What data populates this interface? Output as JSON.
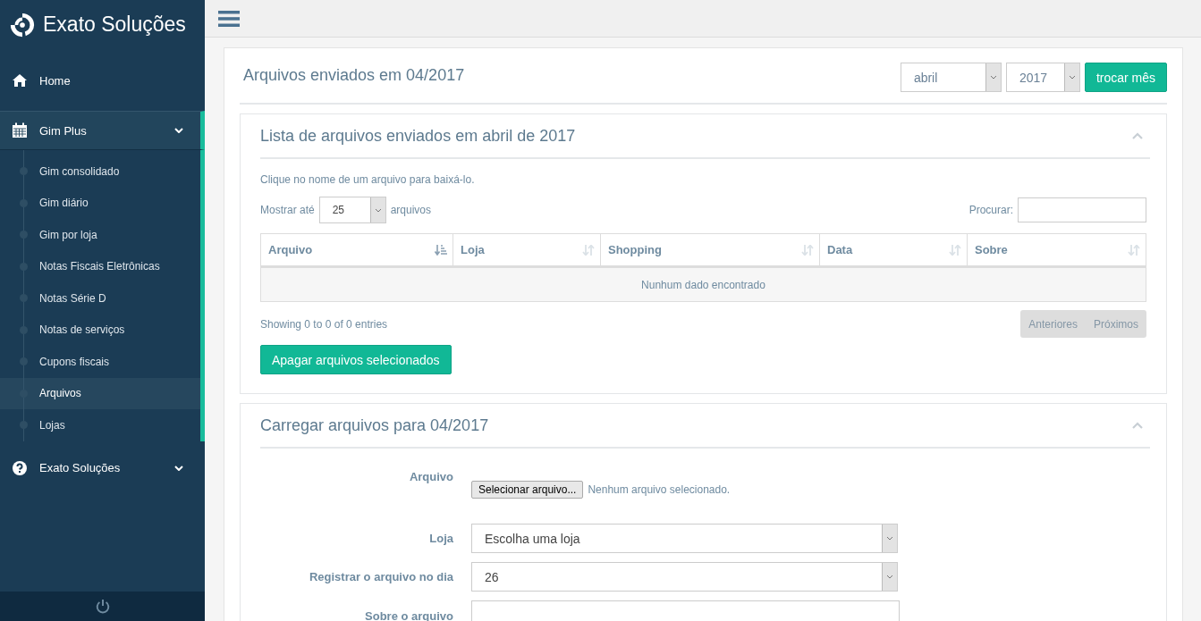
{
  "sidebar": {
    "brand": "Exato Soluções",
    "items": [
      {
        "label": "Home",
        "kind": "link"
      },
      {
        "label": "Gim Plus",
        "kind": "group",
        "expanded": true,
        "children": [
          {
            "label": "Gim consolidado",
            "selected": false
          },
          {
            "label": "Gim diário",
            "selected": false
          },
          {
            "label": "Gim por loja",
            "selected": false
          },
          {
            "label": "Notas Fiscais Eletrônicas",
            "selected": false
          },
          {
            "label": "Notas Série D",
            "selected": false
          },
          {
            "label": "Notas de serviços",
            "selected": false
          },
          {
            "label": "Cupons fiscais",
            "selected": false
          },
          {
            "label": "Arquivos",
            "selected": true
          },
          {
            "label": "Lojas",
            "selected": false
          }
        ]
      },
      {
        "label": "Exato Soluções",
        "kind": "group",
        "expanded": false
      }
    ]
  },
  "page": {
    "title": "Arquivos enviados em 04/2017",
    "month": "abril",
    "year": "2017",
    "change_button": "trocar mês"
  },
  "files_panel": {
    "title": "Lista de arquivos enviados em abril de 2017",
    "hint": "Clique no nome de um arquivo para baixá-lo.",
    "length_label": "Mostrar até",
    "length_value": "25",
    "length_suffix": "arquivos",
    "search_label": "Procurar:",
    "columns": [
      {
        "label": "Arquivo",
        "sorted": true
      },
      {
        "label": "Loja",
        "sorted": false
      },
      {
        "label": "Shopping",
        "sorted": false
      },
      {
        "label": "Data",
        "sorted": false
      },
      {
        "label": "Sobre",
        "sorted": false
      }
    ],
    "empty": "Nunhum dado encontrado",
    "info": "Showing 0 to 0 of 0 entries",
    "pager": [
      "Anteriores",
      "Próximos"
    ],
    "delete_button": "Apagar arquivos selecionados"
  },
  "upload_panel": {
    "title": "Carregar arquivos para 04/2017",
    "fields": [
      {
        "kind": "file",
        "label": "Arquivo",
        "button": "Selecionar arquivo...",
        "status": "Nenhum arquivo selecionado."
      },
      {
        "kind": "select",
        "label": "Loja",
        "value": "Escolha uma loja"
      },
      {
        "kind": "select",
        "label": "Registrar o arquivo no dia",
        "value": "26"
      },
      {
        "kind": "text",
        "label": "Sobre o arquivo"
      }
    ]
  }
}
